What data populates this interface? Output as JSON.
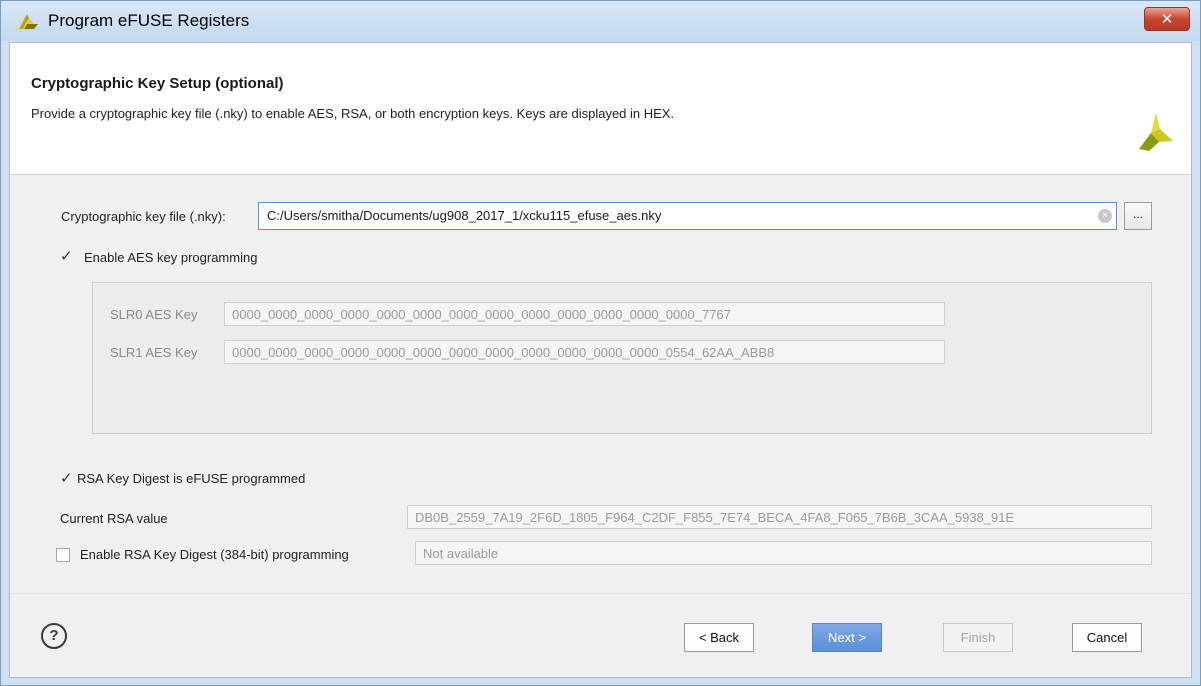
{
  "window": {
    "title": "Program eFUSE Registers",
    "close_label": "✕"
  },
  "header": {
    "title": "Cryptographic Key Setup (optional)",
    "description": "Provide a cryptographic key file (.nky) to enable AES, RSA, or both encryption keys. Keys are displayed in HEX."
  },
  "key_file": {
    "label": "Cryptographic key file (.nky):",
    "value": "C:/Users/smitha/Documents/ug908_2017_1/xcku115_efuse_aes.nky",
    "browse_label": "..."
  },
  "aes": {
    "enable_label": "Enable AES key programming",
    "enabled": true,
    "keys": [
      {
        "label": "SLR0 AES Key",
        "value": "0000_0000_0000_0000_0000_0000_0000_0000_0000_0000_0000_0000_0000_7767"
      },
      {
        "label": "SLR1 AES Key",
        "value": "0000_0000_0000_0000_0000_0000_0000_0000_0000_0000_0000_0000_0554_62AA_ABB8"
      }
    ]
  },
  "rsa": {
    "status_label": "RSA Key Digest is eFUSE programmed",
    "current_label": "Current RSA value",
    "current_value": "DB0B_2559_7A19_2F6D_1805_F964_C2DF_F855_7E74_BECA_4FA8_F065_7B6B_3CAA_5938_91E",
    "enable_label": "Enable RSA Key Digest (384-bit) programming",
    "enabled": false,
    "new_value_placeholder": "Not available"
  },
  "footer": {
    "help_label": "?",
    "back_label": "< Back",
    "next_label": "Next >",
    "finish_label": "Finish",
    "cancel_label": "Cancel"
  },
  "colors": {
    "accent": "#5b8fd8",
    "brand_logo": "#d2d22a"
  },
  "icons": {
    "app": "xilinx-logo-icon",
    "header_logo": "xilinx-logo-icon",
    "help": "help-icon",
    "close": "close-icon"
  }
}
